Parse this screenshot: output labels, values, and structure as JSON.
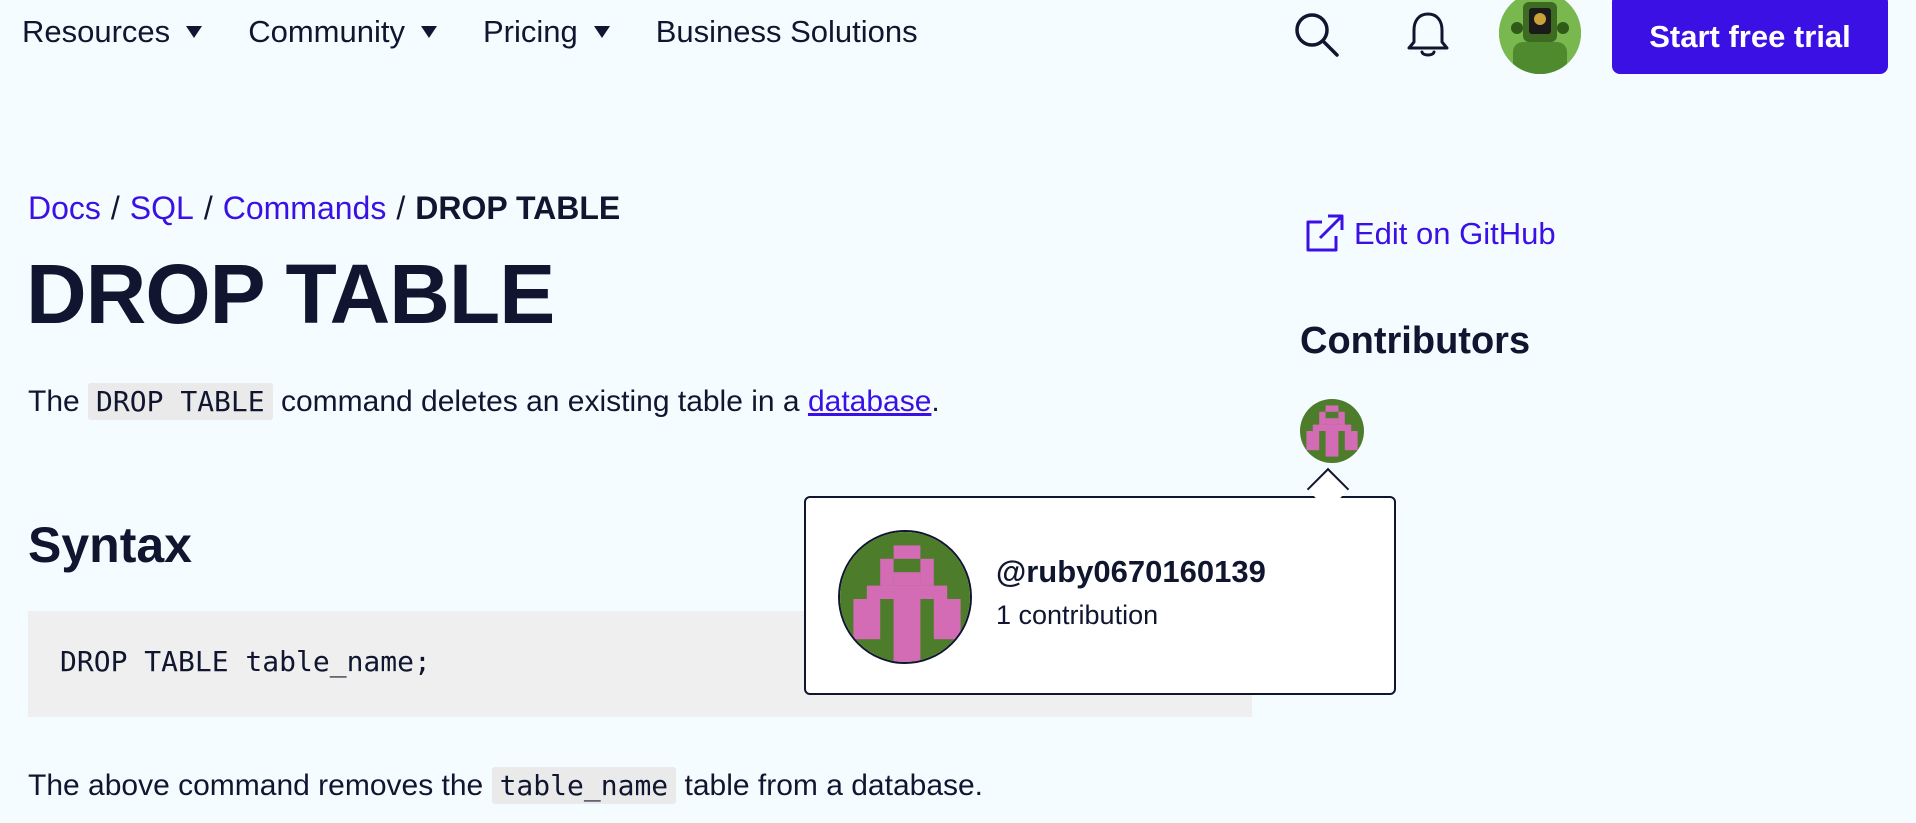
{
  "nav": {
    "items": [
      {
        "label": "Resources",
        "has_caret": true
      },
      {
        "label": "Community",
        "has_caret": true
      },
      {
        "label": "Pricing",
        "has_caret": true
      },
      {
        "label": "Business Solutions",
        "has_caret": false
      }
    ],
    "search_icon": "search-icon",
    "bell_icon": "bell-icon",
    "trial_label": "Start free trial",
    "accent_color": "#3a10e5"
  },
  "breadcrumb": {
    "items": [
      "Docs",
      "SQL",
      "Commands"
    ],
    "separator": "/",
    "current": "DROP TABLE"
  },
  "page": {
    "title": "DROP TABLE",
    "intro_before": "The",
    "intro_code": "DROP TABLE",
    "intro_middle": "command deletes an existing table in a",
    "intro_link": "database",
    "intro_after": ".",
    "syntax_heading": "Syntax",
    "code": "DROP TABLE table_name;",
    "after_before": "The above command removes the",
    "after_code": "table_name",
    "after_after": "table from a database."
  },
  "sidebar": {
    "edit_label": "Edit on GitHub",
    "edit_icon": "external-link-icon",
    "contributors_heading": "Contributors"
  },
  "popover": {
    "handle": "@ruby0670160139",
    "count": "1 contribution"
  },
  "colors": {
    "background": "#f5fcff",
    "text": "#10162f",
    "identicon_bg": "#4d7c2a",
    "identicon_fg": "#d46bb5"
  }
}
